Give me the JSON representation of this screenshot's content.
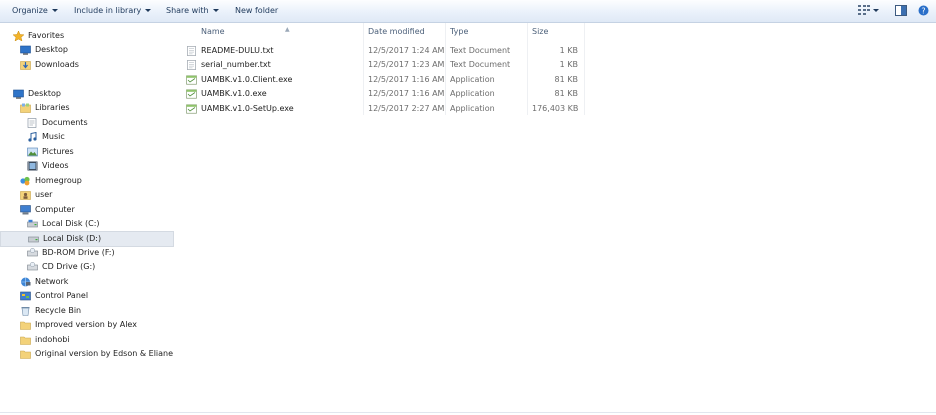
{
  "toolbar": {
    "organize": "Organize",
    "include_in_library": "Include in library",
    "share_with": "Share with",
    "new_folder": "New folder"
  },
  "nav": {
    "favorites": "Favorites",
    "desktop_fav": "Desktop",
    "downloads": "Downloads",
    "desktop": "Desktop",
    "libraries": "Libraries",
    "documents": "Documents",
    "music": "Music",
    "pictures": "Pictures",
    "videos": "Videos",
    "homegroup": "Homegroup",
    "user": "user",
    "computer": "Computer",
    "local_c": "Local Disk (C:)",
    "local_d": "Local Disk (D:)",
    "bd_rom": "BD-ROM Drive (F:)",
    "cd_drive": "CD Drive (G:)",
    "network": "Network",
    "control_panel": "Control Panel",
    "recycle_bin": "Recycle Bin",
    "improved": "Improved version by Alex",
    "indohobi": "indohobi",
    "original": "Original version by Edson & Eliane"
  },
  "columns": {
    "name": "Name",
    "date": "Date modified",
    "type": "Type",
    "size": "Size"
  },
  "files": [
    {
      "name": "README-DULU.txt",
      "date": "12/5/2017 1:24 AM",
      "type": "Text Document",
      "size": "1 KB",
      "icon": "text-file-icon"
    },
    {
      "name": "serial_number.txt",
      "date": "12/5/2017 1:23 AM",
      "type": "Text Document",
      "size": "1 KB",
      "icon": "text-file-icon"
    },
    {
      "name": "UAMBK.v1.0.Client.exe",
      "date": "12/5/2017 1:16 AM",
      "type": "Application",
      "size": "81 KB",
      "icon": "application-icon"
    },
    {
      "name": "UAMBK.v1.0.exe",
      "date": "12/5/2017 1:16 AM",
      "type": "Application",
      "size": "81 KB",
      "icon": "application-icon"
    },
    {
      "name": "UAMBK.v1.0-SetUp.exe",
      "date": "12/5/2017 2:27 AM",
      "type": "Application",
      "size": "176,403 KB",
      "icon": "application-icon"
    }
  ]
}
